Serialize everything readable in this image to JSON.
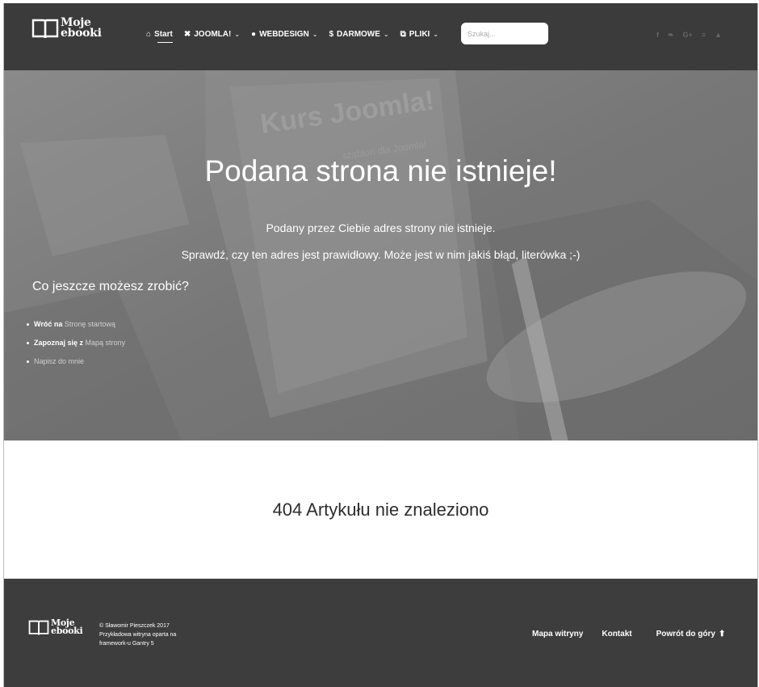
{
  "header": {
    "logo_line1": "Moje",
    "logo_line2": "ebooki",
    "nav": [
      {
        "label": "Start",
        "icon": "home-icon",
        "glyph": "⌂",
        "dropdown": false
      },
      {
        "label": "JOOMLA!",
        "icon": "joomla-icon",
        "glyph": "✖",
        "dropdown": true
      },
      {
        "label": "WEBDESIGN",
        "icon": "globe-icon",
        "glyph": "●",
        "dropdown": true
      },
      {
        "label": "DARMOWE",
        "icon": "dollar-icon",
        "glyph": "$",
        "dropdown": true
      },
      {
        "label": "PLIKI",
        "icon": "files-icon",
        "glyph": "⧉",
        "dropdown": true
      }
    ],
    "chevron": "⌄",
    "search_placeholder": "Szukaj...",
    "social": [
      {
        "name": "facebook-icon",
        "glyph": "f"
      },
      {
        "name": "twitter-icon",
        "glyph": "❧"
      },
      {
        "name": "google-plus-icon",
        "glyph": "G+"
      },
      {
        "name": "rss-icon",
        "glyph": "≡"
      },
      {
        "name": "user-icon",
        "glyph": "▲"
      }
    ]
  },
  "hero": {
    "title": "Podana strona nie istnieje!",
    "line1": "Podany przez Ciebie adres strony nie istnieje.",
    "line2": "Sprawdź, czy ten adres jest prawidłowy. Może jest w nim jakiś błąd, literówka ;-)",
    "subtitle": "Co jeszcze możesz zrobić?",
    "links": [
      {
        "prefix": "Wróć na",
        "link": "Stronę startową"
      },
      {
        "prefix": "Zapoznaj się z",
        "link": "Mapą strony"
      },
      {
        "prefix": "",
        "link": "Napisz do mnie"
      }
    ]
  },
  "main": {
    "title": "404 Artykułu nie znaleziono"
  },
  "footer": {
    "logo_line1": "Moje",
    "logo_line2": "ebooki",
    "copyright_1": "© Sławomir Pieszczek 2017",
    "copyright_2": "Przykładowa witryna oparta na",
    "copyright_3": "framework-u Gantry 5",
    "sitemap": "Mapa witryny",
    "contact": "Kontakt",
    "back_to_top": "Powrót do góry",
    "arrow": "⬆"
  },
  "colors": {
    "header_bg": "#3b3b3b",
    "hero_bg": "#7a7a7a",
    "footer_bg": "#3d3d3d"
  }
}
